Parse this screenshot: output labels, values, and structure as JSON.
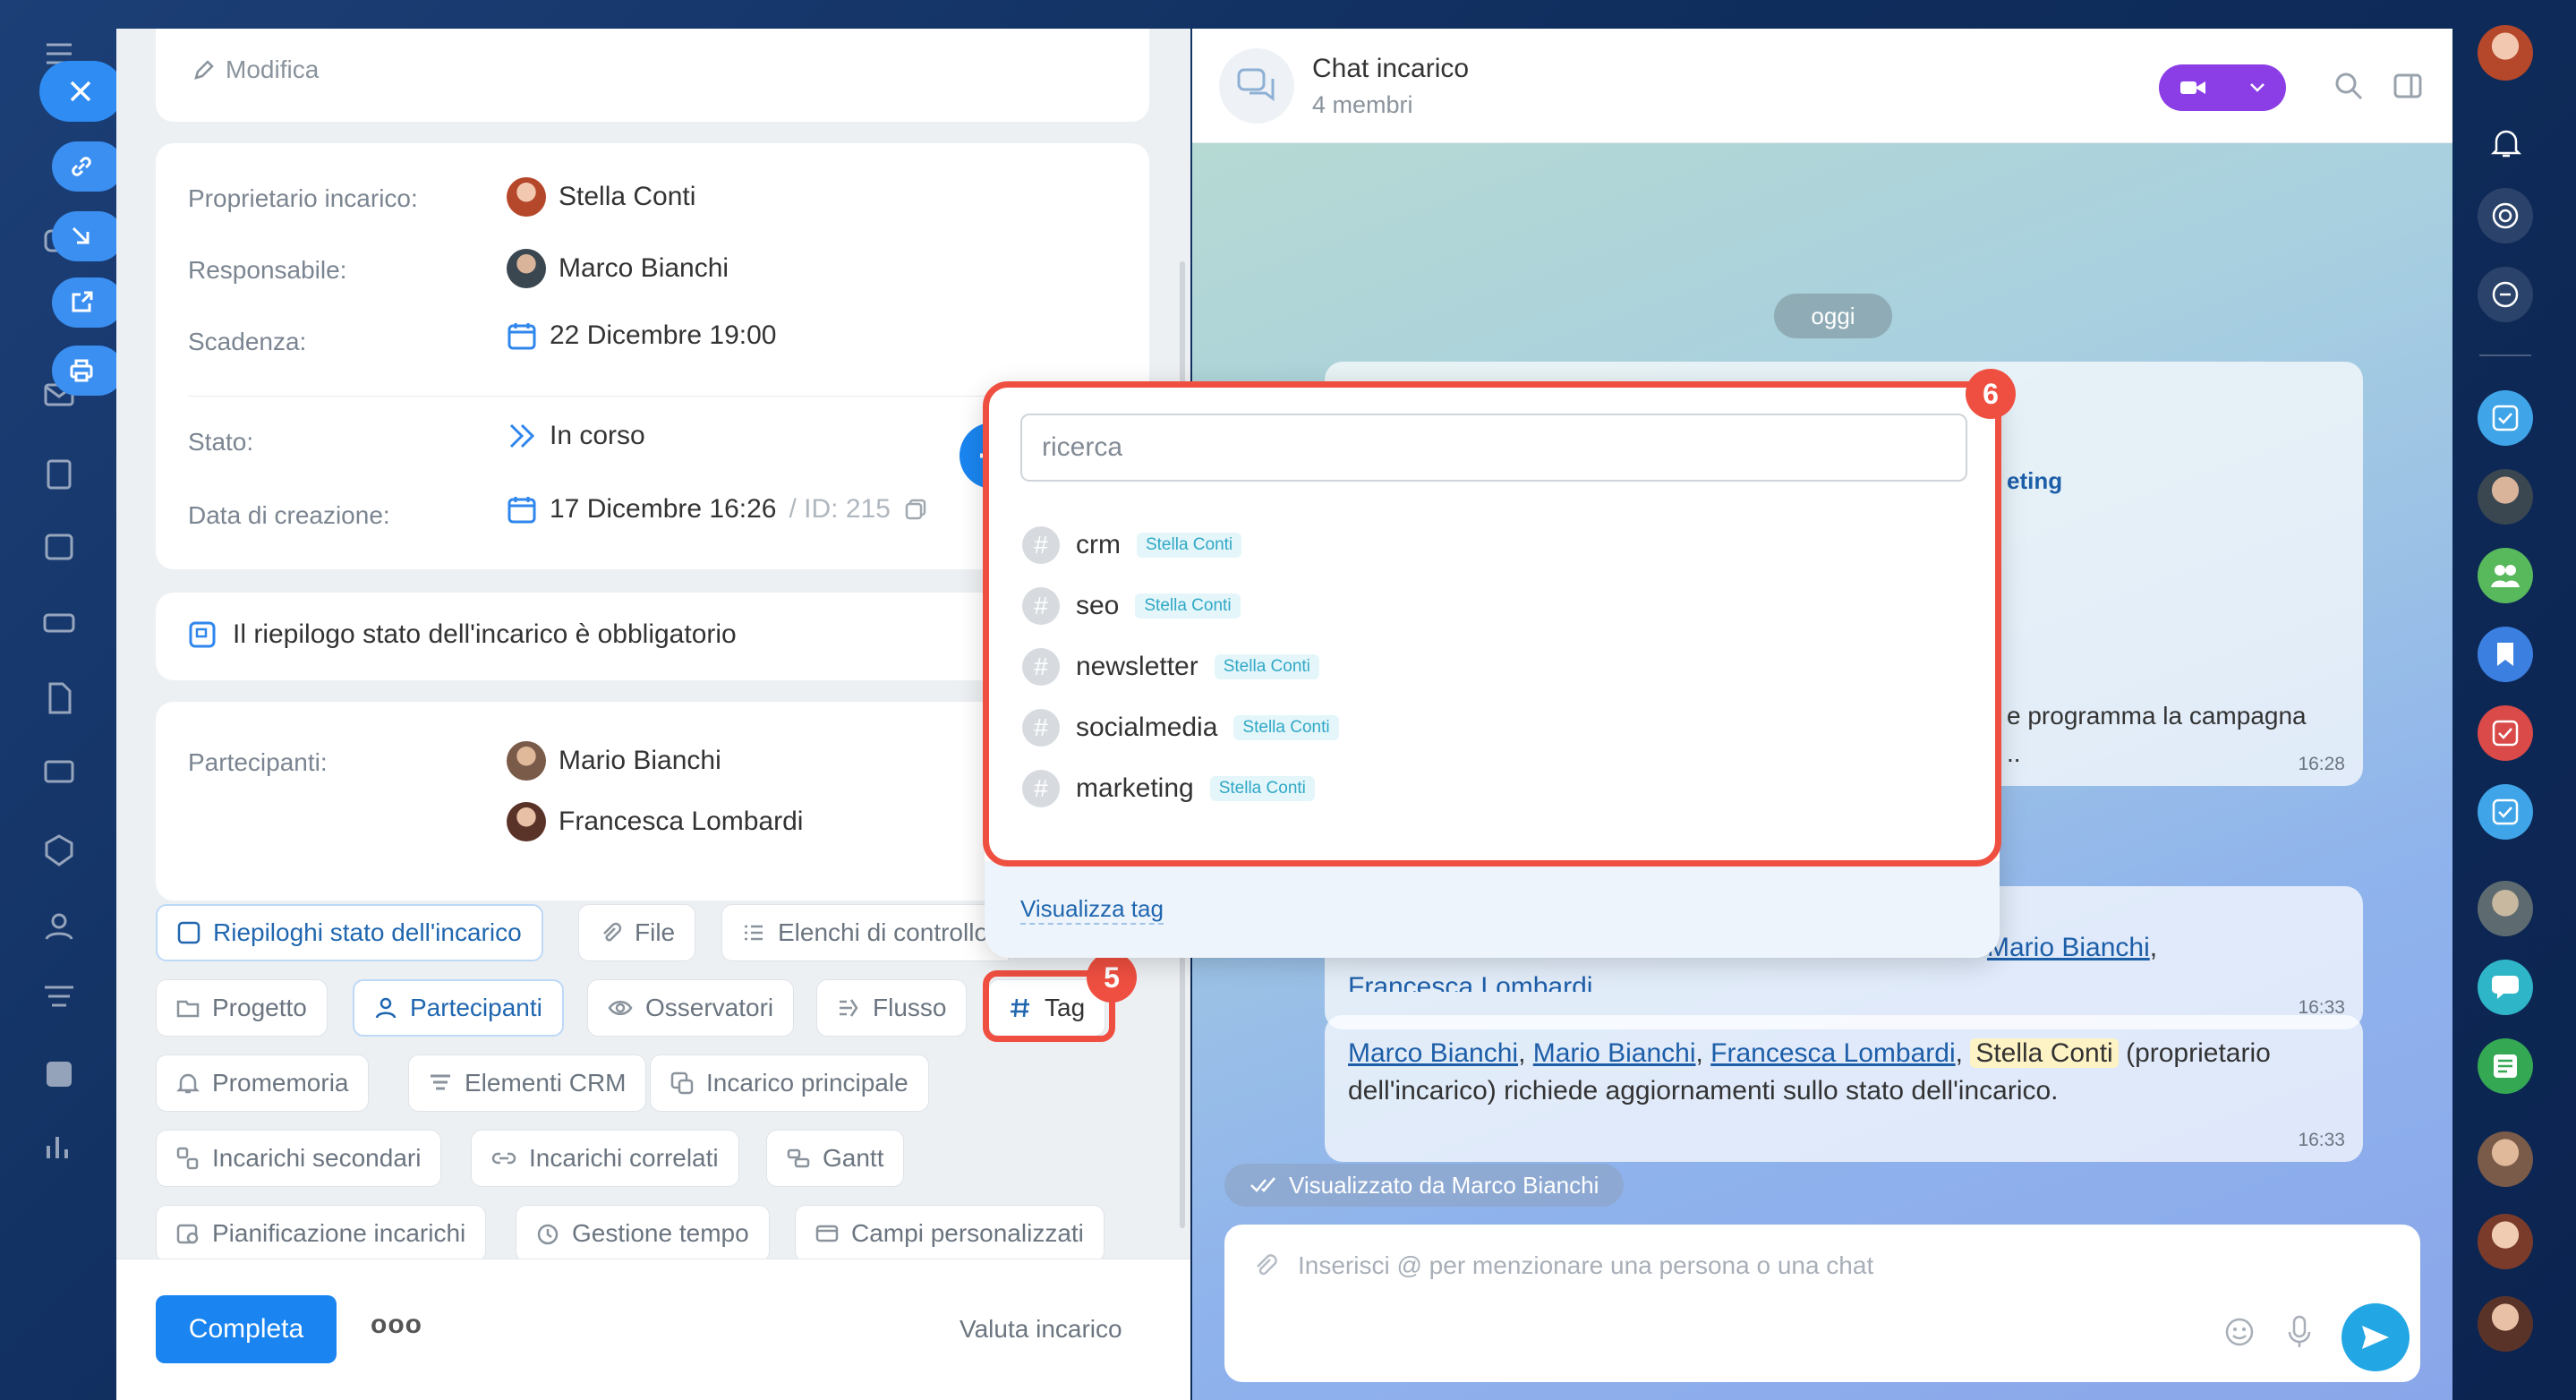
{
  "task": {
    "edit_label": "Modifica",
    "owner_label": "Proprietario incarico:",
    "owner_name": "Stella Conti",
    "responsible_label": "Responsabile:",
    "responsible_name": "Marco Bianchi",
    "deadline_label": "Scadenza:",
    "deadline_value": "22 Dicembre 19:00",
    "status_label": "Stato:",
    "status_value": "In corso",
    "created_label": "Data di creazione:",
    "created_value": "17 Dicembre 16:26",
    "id_value": "/ ID: 215",
    "summary_notice": "Il riepilogo stato dell'incarico è obbligatorio",
    "participants_label": "Partecipanti:",
    "participants": [
      "Mario Bianchi",
      "Francesca Lombardi"
    ]
  },
  "chips": {
    "summaries": "Riepiloghi stato dell'incarico",
    "file": "File",
    "checklists": "Elenchi di controllo",
    "project": "Progetto",
    "participants": "Partecipanti",
    "observers": "Osservatori",
    "flow": "Flusso",
    "tag": "Tag",
    "reminders": "Promemoria",
    "crm": "Elementi CRM",
    "parent": "Incarico principale",
    "subtasks": "Incarichi secondari",
    "related": "Incarichi correlati",
    "gantt": "Gantt",
    "planning": "Pianificazione incarichi",
    "time": "Gestione tempo",
    "custom": "Campi personalizzati"
  },
  "footer": {
    "complete": "Completa",
    "more": "ooo",
    "rate": "Valuta incarico"
  },
  "chat": {
    "title": "Chat incarico",
    "members": "4 membri",
    "today": "oggi",
    "partial_text_1": "eting",
    "partial_text_2": "e programma la campagna",
    "partial_text_3": "..",
    "time_1": "16:28",
    "msg2_mention": "Mario Bianchi",
    "msg2_cut": "Francesca Lombardi.",
    "time_2": "16:33",
    "msg3_m1": "Marco Bianchi",
    "msg3_m2": "Mario Bianchi",
    "msg3_m3": "Francesca Lombardi",
    "msg3_m4": "Stella Conti",
    "msg3_text_a": "(proprietario",
    "msg3_text_b": "dell'incarico) richiede aggiornamenti sullo stato dell'incarico.",
    "time_3": "16:33",
    "seen_by": "Visualizzato da Marco Bianchi",
    "input_placeholder": "Inserisci @ per menzionare una persona o una chat"
  },
  "tag_popup": {
    "search_placeholder": "ricerca",
    "tags": [
      {
        "name": "crm",
        "owner": "Stella Conti"
      },
      {
        "name": "seo",
        "owner": "Stella Conti"
      },
      {
        "name": "newsletter",
        "owner": "Stella Conti"
      },
      {
        "name": "socialmedia",
        "owner": "Stella Conti"
      },
      {
        "name": "marketing",
        "owner": "Stella Conti"
      }
    ],
    "view_tags": "Visualizza tag"
  },
  "annotations": {
    "badge_tag": "5",
    "badge_popup": "6"
  },
  "colors": {
    "accent": "#1a85f0",
    "highlight": "#ef4f40",
    "video": "#8c3ee6",
    "mention_bg": "#fdf3c4"
  }
}
